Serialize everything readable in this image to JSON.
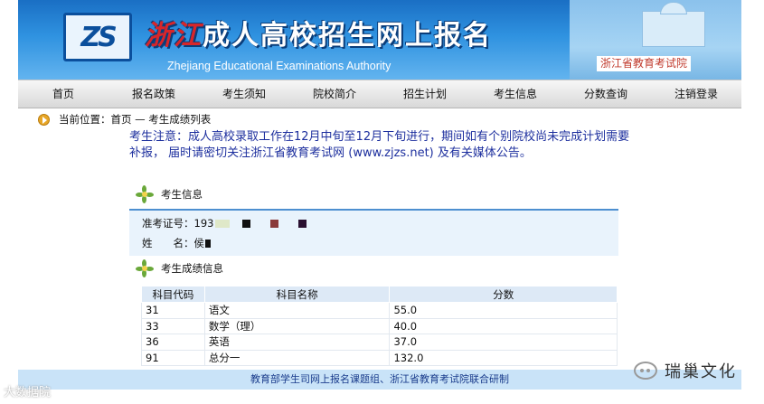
{
  "header": {
    "logo_mark": "ZS",
    "title_prefix": "浙江",
    "title_main": "成人高校招生网上报名",
    "subtitle": "Zhejiang Educational Examinations Authority",
    "org_tag": "浙江省教育考试院"
  },
  "nav": {
    "items": [
      {
        "label": "首页"
      },
      {
        "label": "报名政策"
      },
      {
        "label": "考生须知"
      },
      {
        "label": "院校简介"
      },
      {
        "label": "招生计划"
      },
      {
        "label": "考生信息"
      },
      {
        "label": "分数查询"
      },
      {
        "label": "注销登录"
      }
    ]
  },
  "breadcrumb": {
    "text": "当前位置：首页 — 考生成绩列表"
  },
  "notice": {
    "text": "考生注意：成人高校录取工作在12月中旬至12月下旬进行，期间如有个别院校尚未完成计划需要补报， 届时请密切关注浙江省教育考试网 (www.zjzs.net) 及有关媒体公告。"
  },
  "candidate_info": {
    "section_title": "考生信息",
    "exam_no_label": "准考证号：",
    "exam_no_value": "193",
    "name_label": "姓　　名：",
    "name_value": "侯"
  },
  "score_info": {
    "section_title": "考生成绩信息",
    "columns": [
      "科目代码",
      "科目名称",
      "分数"
    ],
    "rows": [
      {
        "code": "31",
        "name": "语文",
        "score": "55.0"
      },
      {
        "code": "33",
        "name": "数学（理）",
        "score": "40.0"
      },
      {
        "code": "36",
        "name": "英语",
        "score": "37.0"
      },
      {
        "code": "91",
        "name": "总分一",
        "score": "132.0"
      }
    ]
  },
  "footer": {
    "text": "教育部学生司网上报名课题组、浙江省教育考试院联合研制"
  },
  "watermarks": {
    "left": "大数据院",
    "right": "瑞巢文化"
  },
  "colors": {
    "banner_blue": "#2f92e0",
    "notice_text": "#1d2f9e",
    "table_header": "#dde9f6",
    "footer_bg": "#c9e3f8"
  }
}
